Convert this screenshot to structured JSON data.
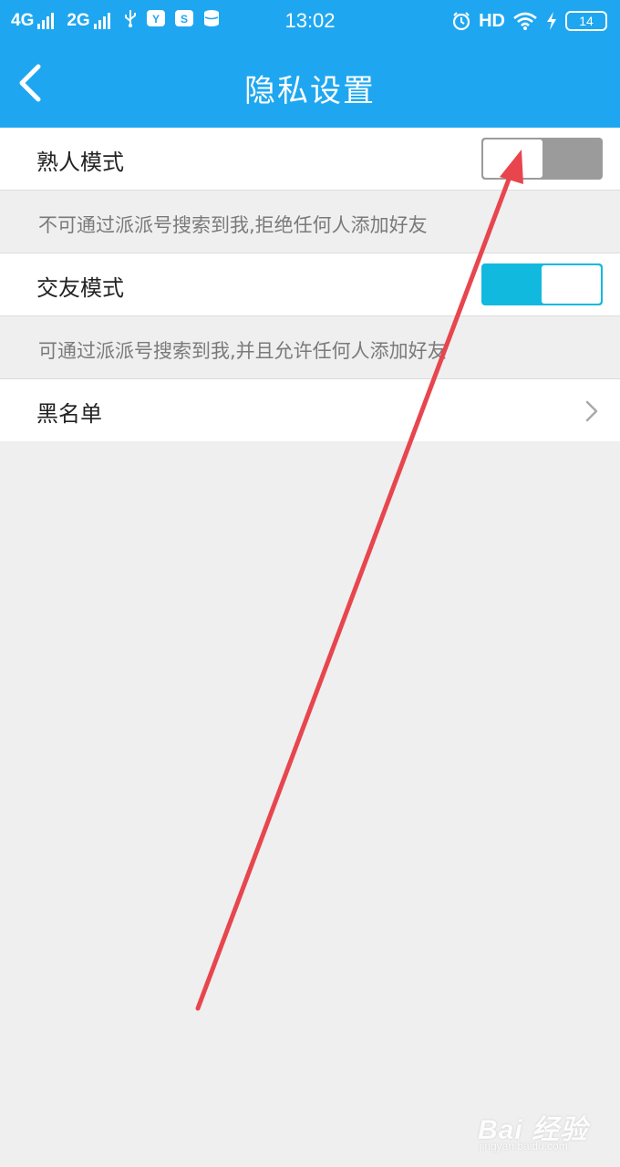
{
  "status_bar": {
    "net1": "4G",
    "net2": "2G",
    "time": "13:02",
    "hd": "HD",
    "battery": "14",
    "icons": [
      "usb-icon",
      "app-notification-icon",
      "sync-notification-icon",
      "storage-icon",
      "alarm-icon",
      "wifi-icon",
      "charging-icon"
    ]
  },
  "nav": {
    "title": "隐私设置",
    "back_icon": "chevron-left-icon"
  },
  "settings": {
    "acquaintance": {
      "label": "熟人模式",
      "enabled": false,
      "hint": "不可通过派派号搜索到我,拒绝任何人添加好友"
    },
    "friend_making": {
      "label": "交友模式",
      "enabled": true,
      "hint": "可通过派派号搜索到我,并且允许任何人添加好友"
    },
    "blacklist": {
      "label": "黑名单",
      "icon": "chevron-right-icon"
    }
  },
  "colors": {
    "header": "#1ea7f0",
    "switch_on": "#12b9de",
    "switch_off": "#9b9b9b",
    "annotation_arrow": "#e8454e"
  },
  "watermark": {
    "brand": "Bai 经验",
    "url": "jingyan.baidu.com"
  }
}
